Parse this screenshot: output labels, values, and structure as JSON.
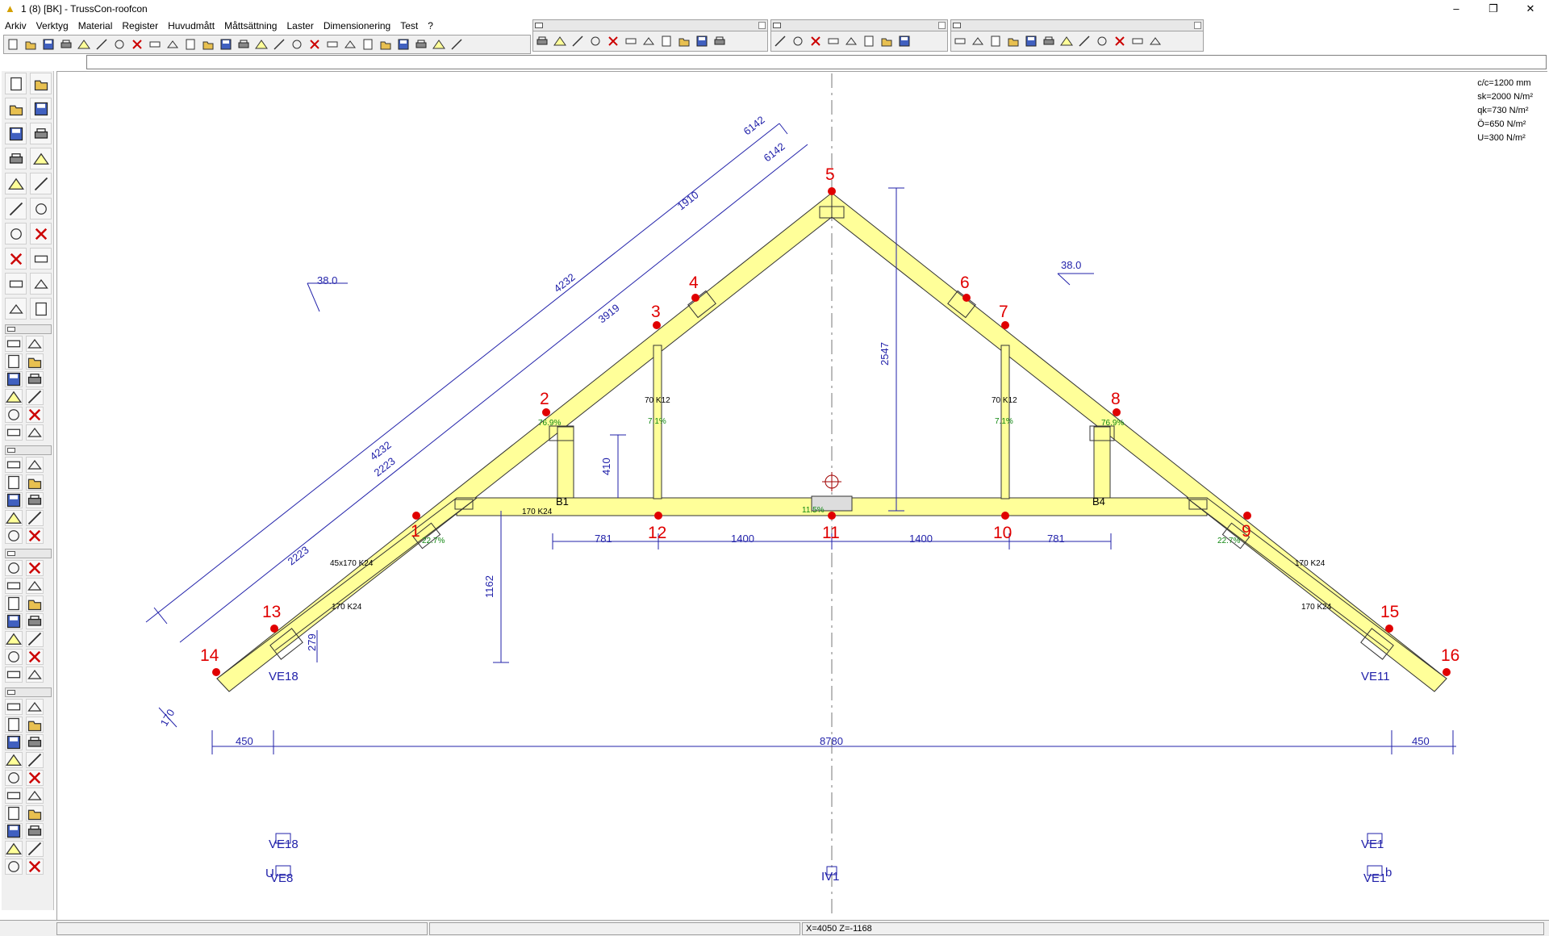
{
  "window": {
    "title": "1 (8) [BK] - TrussCon-roofcon",
    "minimize": "–",
    "maximize": "❐",
    "close": "✕"
  },
  "menu": [
    "Arkiv",
    "Verktyg",
    "Material",
    "Register",
    "Huvudmått",
    "Måttsättning",
    "Laster",
    "Dimensionering",
    "Test",
    "?"
  ],
  "toolbar_icons": {
    "file": [
      "new-icon",
      "open-icon",
      "save-icon",
      "print-icon",
      "printer-setup-icon"
    ],
    "edit": [
      "truss-icon",
      "timber-stack-icon",
      "table-icon",
      "roof-icon",
      "key-icon",
      "key-multi-icon",
      "eyeglasses-icon",
      "undo-icon",
      "redo-icon"
    ],
    "view": [
      "house-icon",
      "grid-icon",
      "wall-icon",
      "bucket-icon",
      "eye-icon",
      "select-node-icon",
      "node-a-icon",
      "node-b-icon",
      "arrow-icon",
      "slope-icon",
      "slope-2-icon",
      "slope-3-icon"
    ],
    "draw1": [
      "line-a-icon",
      "line-b-icon",
      "line-c-icon",
      "line-d-icon",
      "circle-plus-icon",
      "clock-icon",
      "circle-icon",
      "delete-x-icon",
      "hatch-icon",
      "frame-icon",
      "multi-icon"
    ],
    "draw2": [
      "brace-icon",
      "brace-2-icon",
      "frame-select-icon",
      "pointer-icon",
      "cross-icon",
      "cross-2-icon",
      "wrench-icon",
      "truss-edit-icon"
    ],
    "shapes": [
      "hand-icon",
      "scale-icon",
      "roof-a-icon",
      "roof-b-icon",
      "roof-c-icon",
      "roof-d-icon",
      "beam-a-icon",
      "beam-b-icon",
      "beam-c-icon",
      "beam-d-icon",
      "beam-delete-icon",
      "delete-red-icon"
    ]
  },
  "load_info": [
    "c/c=1200 mm",
    "sk=2000 N/m²",
    "qk=730 N/m²",
    "Ö=650 N/m²",
    "U=300 N/m²"
  ],
  "nodes": [
    "1",
    "2",
    "3",
    "4",
    "5",
    "6",
    "7",
    "8",
    "9",
    "10",
    "11",
    "12",
    "13",
    "14",
    "15",
    "16"
  ],
  "dimensions": {
    "top_outer_a": "6142",
    "top_outer_b": "6142",
    "top_upper_seg": "1910",
    "top_mid_a": "4232",
    "top_mid_b": "3919",
    "lower_a": "4232",
    "lower_b": "2223",
    "lower_c": "2223",
    "height": "2547",
    "strut_h": "410",
    "eave_h": "1162",
    "small_h": "279",
    "foot": "170",
    "bottom_left": "781",
    "bottom_mid_left": "1400",
    "bottom_mid_right": "1400",
    "bottom_right": "781",
    "overall_left": "450",
    "overall": "8780",
    "overall_right": "450"
  },
  "angles": {
    "left": "38.0",
    "right": "38.0"
  },
  "member_labels": {
    "post_left": "70 K12",
    "post_right": "70 K12",
    "chord_left": "170 K24",
    "rafter_top_left": "45x170 K24",
    "rafter_bot_left": "170 K24",
    "rafter_top_right": "170 K24",
    "rafter_bot_right": "170 K24"
  },
  "utilization": {
    "u1": "22.7%",
    "u2": "76.9%",
    "u3": "7.1%",
    "u4": "7.1%",
    "u5": "76.9%",
    "u6": "11.5%",
    "u7": "22.7%"
  },
  "supports": {
    "b1": "B1",
    "b4": "B4",
    "ve18": "VE18",
    "ve11": "VE11"
  },
  "bottom_symbols": {
    "ve18_a": "VE18",
    "ve18_b": "VE8",
    "ve18_c": "U",
    "iv1": "IV1",
    "ve11_a": "VE1",
    "ve11_b": "VE1",
    "ve11_c": "b"
  },
  "status": {
    "coords": "X=4050  Z=-1168"
  }
}
